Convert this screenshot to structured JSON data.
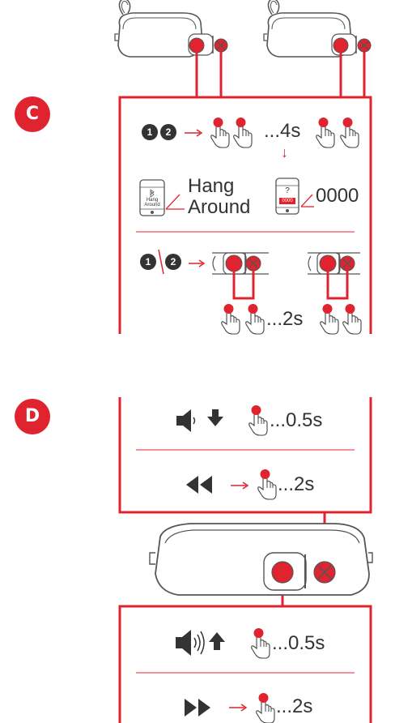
{
  "colors": {
    "accent": "#e0242f",
    "line": "#555555",
    "text": "#333333"
  },
  "section_c": {
    "label": "C",
    "step_numbers": [
      "1",
      "2"
    ],
    "hold_time": "...4s",
    "pair_down_arrow": "↓",
    "phone_hang_around_screen": [
      "Hang",
      "Around"
    ],
    "pair_name": [
      "Hang",
      "Around"
    ],
    "phone_pin_screen": [
      "?",
      "0000"
    ],
    "pin_code": "0000",
    "hold_time_2": "...2s",
    "separator_slash": "\\"
  },
  "section_d": {
    "label": "D",
    "volume_down_time": "...0.5s",
    "previous_track_time": "...2s",
    "volume_up_time": "...0.5s",
    "next_track_time": "...2s"
  },
  "icons": [
    "speaker-device-icon",
    "power-button-icon",
    "bluetooth-button-icon",
    "hand-press-icon",
    "phone-icon",
    "volume-down-icon",
    "volume-up-icon",
    "arrow-down-icon",
    "arrow-up-icon",
    "rewind-icon",
    "fast-forward-icon",
    "arrow-right-icon"
  ]
}
